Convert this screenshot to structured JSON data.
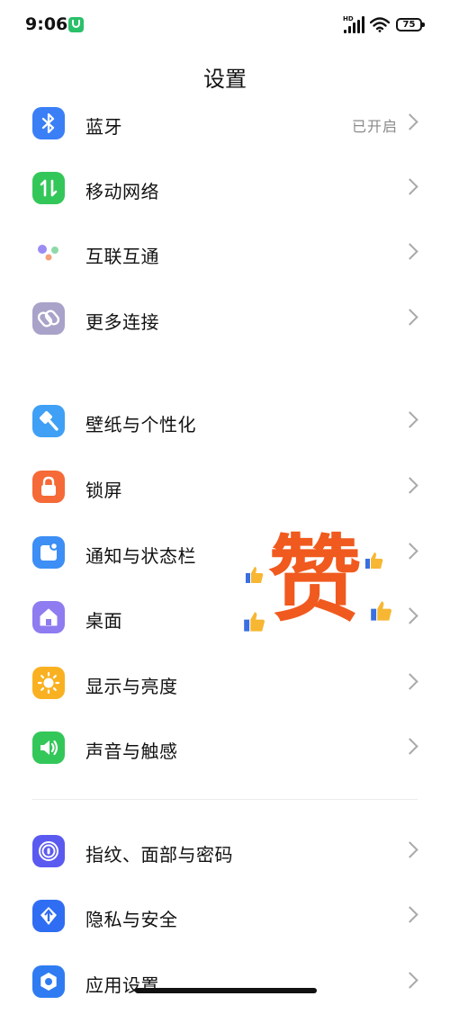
{
  "status_bar": {
    "time": "9:06",
    "signal_label": "HD",
    "battery": "75"
  },
  "title": "设置",
  "sections": [
    {
      "items": [
        {
          "label": "蓝牙",
          "value": "已开启",
          "icon": "bluetooth-icon",
          "color": "#3a7ff6"
        },
        {
          "label": "移动网络",
          "value": "",
          "icon": "mobile-data-icon",
          "color": "#33c759"
        },
        {
          "label": "互联互通",
          "value": "",
          "icon": "interconnect-icon",
          "color": "#ffffff"
        },
        {
          "label": "更多连接",
          "value": "",
          "icon": "link-icon",
          "color": "#a9a2c9"
        }
      ]
    },
    {
      "items": [
        {
          "label": "壁纸与个性化",
          "value": "",
          "icon": "paint-icon",
          "color": "#3fa0f5"
        },
        {
          "label": "锁屏",
          "value": "",
          "icon": "lock-icon",
          "color": "#f56a37"
        },
        {
          "label": "通知与状态栏",
          "value": "",
          "icon": "notification-icon",
          "color": "#3d8ef5"
        },
        {
          "label": "桌面",
          "value": "",
          "icon": "home-icon",
          "color": "#8e7cf0"
        },
        {
          "label": "显示与亮度",
          "value": "",
          "icon": "brightness-icon",
          "color": "#f9b122"
        },
        {
          "label": "声音与触感",
          "value": "",
          "icon": "sound-icon",
          "color": "#33c759"
        }
      ]
    },
    {
      "items": [
        {
          "label": "指纹、面部与密码",
          "value": "",
          "icon": "fingerprint-icon",
          "color": "#5a5af0"
        },
        {
          "label": "隐私与安全",
          "value": "",
          "icon": "privacy-icon",
          "color": "#2f6df2"
        },
        {
          "label": "应用设置",
          "value": "",
          "icon": "app-settings-icon",
          "color": "#2f7cf2"
        }
      ]
    }
  ],
  "sticker": {
    "text": "赞",
    "color": "#f05a1e"
  }
}
